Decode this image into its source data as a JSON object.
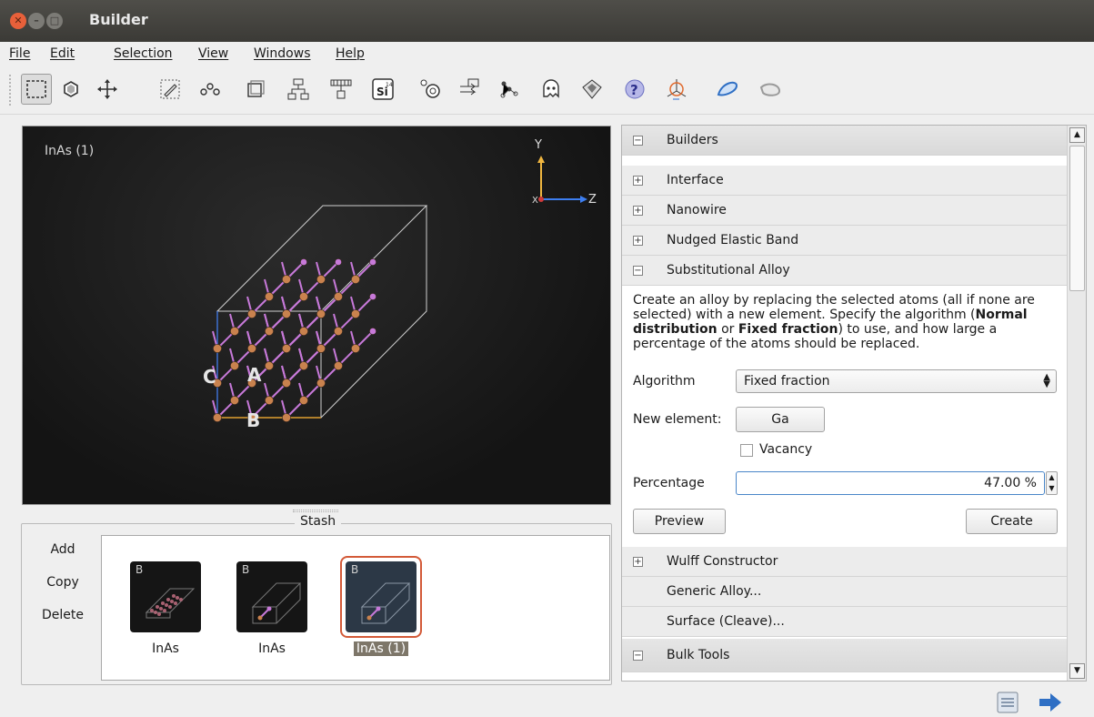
{
  "window": {
    "title": "Builder"
  },
  "menu": [
    "File",
    "Edit",
    "Selection",
    "View",
    "Windows",
    "Help"
  ],
  "toolbar": {
    "tools": [
      "select-tool",
      "hexagon-tool",
      "move-tool",
      "edit-tool",
      "bonds-tool",
      "cell-tool",
      "tree-tool",
      "grid-tool",
      "si-element-tool",
      "atom-tool",
      "arrow-tool",
      "molecule-tool",
      "ghost-tool",
      "cube-tool",
      "help-tool",
      "axes-tool",
      "shape1-tool",
      "shape2-tool"
    ],
    "element_symbol": "Si",
    "element_number": "14"
  },
  "viewport": {
    "label": "InAs (1)",
    "axes": {
      "y": "Y",
      "z": "Z",
      "x": "X"
    },
    "cell_labels": {
      "c": "C",
      "a": "A",
      "b": "B"
    }
  },
  "stash": {
    "title": "Stash",
    "actions": [
      "Add",
      "Copy",
      "Delete"
    ],
    "items": [
      {
        "badge": "B",
        "label": "InAs"
      },
      {
        "badge": "B",
        "label": "InAs"
      },
      {
        "badge": "B",
        "label": "InAs (1)"
      }
    ]
  },
  "builders": {
    "header": "Builders",
    "sections": [
      "Interface",
      "Nanowire",
      "Nudged Elastic Band",
      "Substitutional Alloy"
    ],
    "alloy": {
      "desc_1": "Create an alloy by replacing the selected atoms (all if none are selected) with a new element. Specify the algorithm (",
      "desc_bold1": "Normal distribution",
      "desc_2": " or ",
      "desc_bold2": "Fixed fraction",
      "desc_3": ") to use, and how large a percentage of the atoms should be replaced.",
      "algorithm_label": "Algorithm",
      "algorithm_value": "Fixed fraction",
      "new_element_label": "New element:",
      "new_element_value": "Ga",
      "vacancy_label": "Vacancy",
      "percentage_label": "Percentage",
      "percentage_value": "47.00 %",
      "preview_label": "Preview",
      "create_label": "Create"
    },
    "after_sections": [
      "Wulff Constructor",
      "Generic Alloy...",
      "Surface (Cleave)..."
    ],
    "bulk_tools": "Bulk Tools"
  },
  "colors": {
    "accent": "#d35a38",
    "focus": "#4a86c8",
    "atom_in": "#c9824e",
    "atom_as": "#c779d9"
  }
}
